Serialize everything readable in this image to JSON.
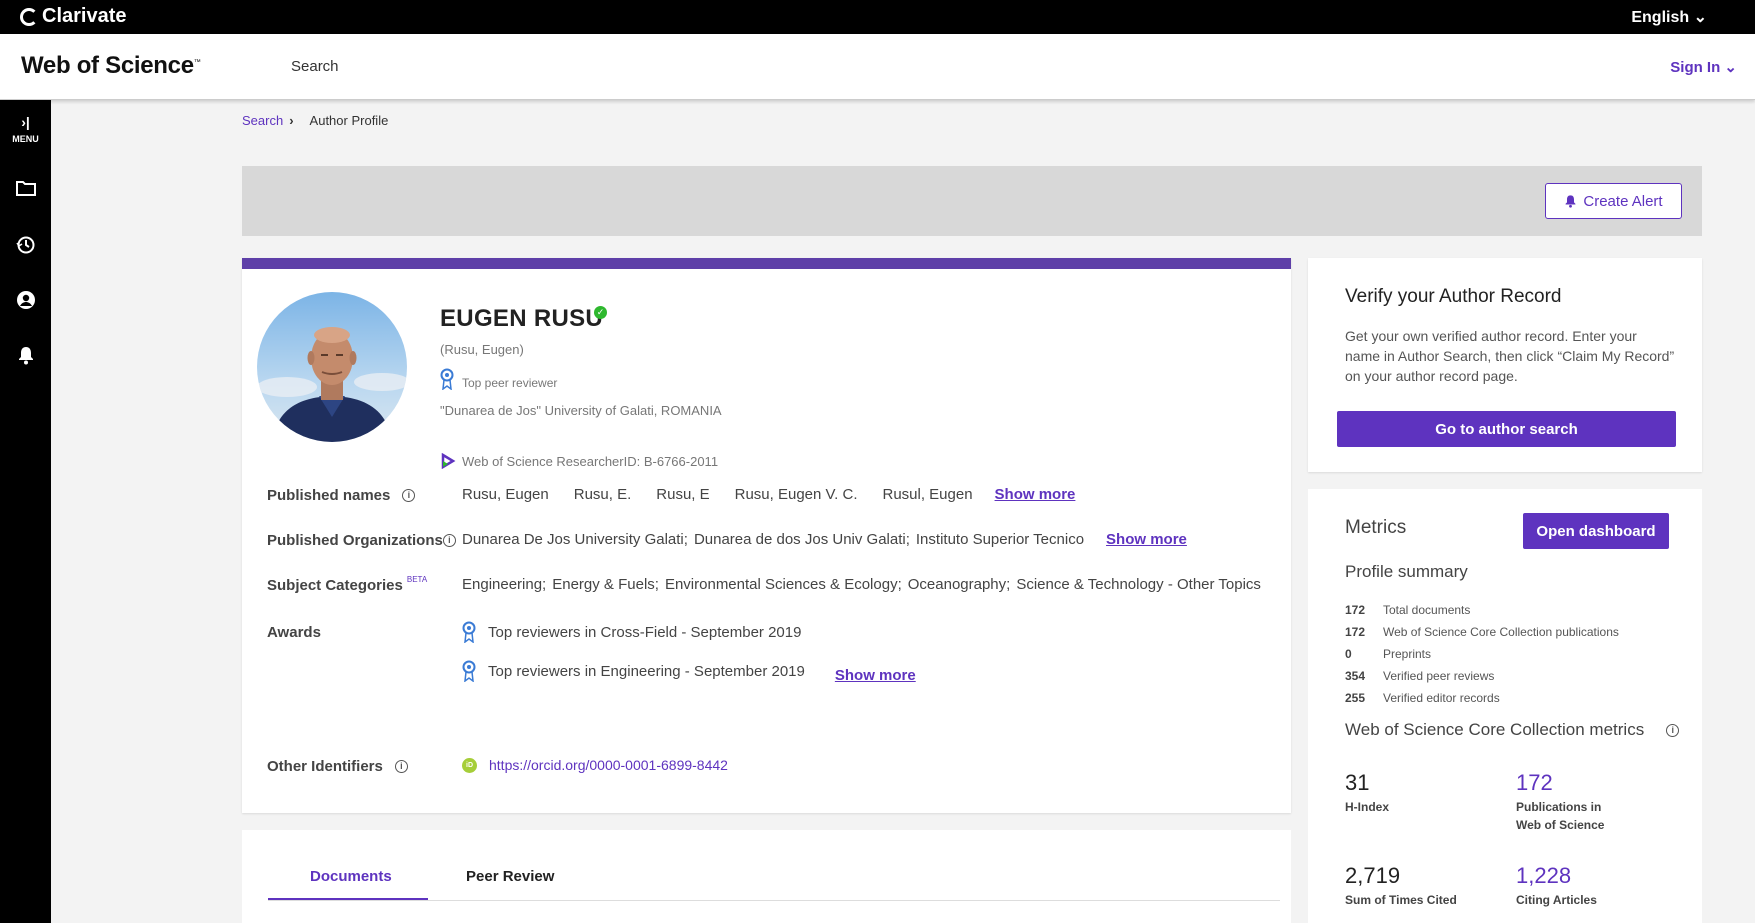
{
  "topbar": {
    "brand": "Clarivate",
    "language": "English ⌄"
  },
  "header": {
    "logo": "Web of Science",
    "logo_tm": "™",
    "search": "Search",
    "sign_in": "Sign In ⌄"
  },
  "sidebar": {
    "menu_label": "MENU",
    "items": [
      "folder-icon",
      "history-icon",
      "profile-icon",
      "bell-icon"
    ]
  },
  "breadcrumb": {
    "search": "Search",
    "separator": "›",
    "current": "Author Profile"
  },
  "alert": {
    "create_alert": "Create Alert"
  },
  "profile": {
    "name": "EUGEN RUSU",
    "alt_name": "(Rusu, Eugen)",
    "badge": "Top peer reviewer",
    "affiliation": "\"Dunarea de Jos\" University of Galati, ROMANIA",
    "researcher_id": "Web of Science ResearcherID: B-6766-2011",
    "published_names_label": "Published names",
    "published_names": [
      "Rusu, Eugen",
      "Rusu, E.",
      "Rusu, E",
      "Rusu, Eugen V. C.",
      "Rusul, Eugen"
    ],
    "published_orgs_label": "Published Organizations",
    "published_orgs": [
      "Dunarea De Jos University Galati;",
      "Dunarea de dos Jos Univ Galati;",
      "Instituto Superior Tecnico"
    ],
    "subject_label": "Subject Categories",
    "beta": "BETA",
    "subjects": [
      "Engineering;",
      "Energy & Fuels;",
      "Environmental Sciences & Ecology;",
      "Oceanography;",
      "Science & Technology - Other Topics"
    ],
    "awards_label": "Awards",
    "awards": [
      "Top reviewers in Cross-Field - September 2019",
      "Top reviewers in Engineering - September 2019"
    ],
    "other_ids_label": "Other Identifiers",
    "orcid_badge": "iD",
    "orcid": "https://orcid.org/0000-0001-6899-8442",
    "show_more": "Show more"
  },
  "tabs": {
    "documents": "Documents",
    "peer_review": "Peer Review"
  },
  "verify": {
    "title": "Verify your Author Record",
    "text": "Get your own verified author record. Enter your name in Author Search, then click “Claim My Record” on your author record page.",
    "button": "Go to author search"
  },
  "metrics": {
    "title": "Metrics",
    "dashboard": "Open dashboard",
    "profile_summary": "Profile summary",
    "stats": [
      {
        "num": "172",
        "label": "Total documents"
      },
      {
        "num": "172",
        "label": "Web of Science Core Collection publications"
      },
      {
        "num": "0",
        "label": "Preprints"
      },
      {
        "num": "354",
        "label": "Verified peer reviews"
      },
      {
        "num": "255",
        "label": "Verified editor records"
      }
    ],
    "core_title": "Web of Science Core Collection metrics",
    "h_index": "31",
    "h_index_label": "H-Index",
    "publications": "172",
    "publications_label_1": "Publications in",
    "publications_label_2": "Web of Science",
    "times_cited": "2,719",
    "times_cited_label": "Sum of Times Cited",
    "citing": "1,228",
    "citing_label": "Citing Articles"
  },
  "colors": {
    "accent": "#5e33bf",
    "band": "#5e3fa8",
    "verified": "#2eb82e",
    "orcid": "#a6ce39"
  }
}
